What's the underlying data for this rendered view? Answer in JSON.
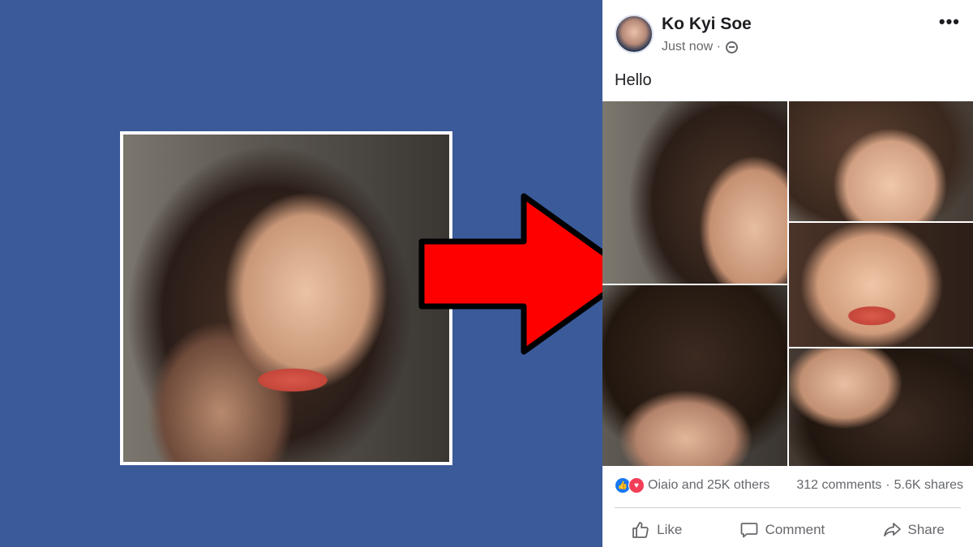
{
  "post": {
    "author": "Ko Kyi Soe",
    "time": "Just now ·",
    "text": "Hello",
    "more": "•••",
    "reactions_summary": "Oiaio and 25K others",
    "comments_count": "312 comments",
    "shares_count": "5.6K shares",
    "actions": {
      "like": "Like",
      "comment": "Comment",
      "share": "Share"
    }
  },
  "colors": {
    "background": "#3b5a9a",
    "arrow": "#ff0000",
    "like_blue": "#1877f2",
    "love_red": "#f33e58"
  }
}
